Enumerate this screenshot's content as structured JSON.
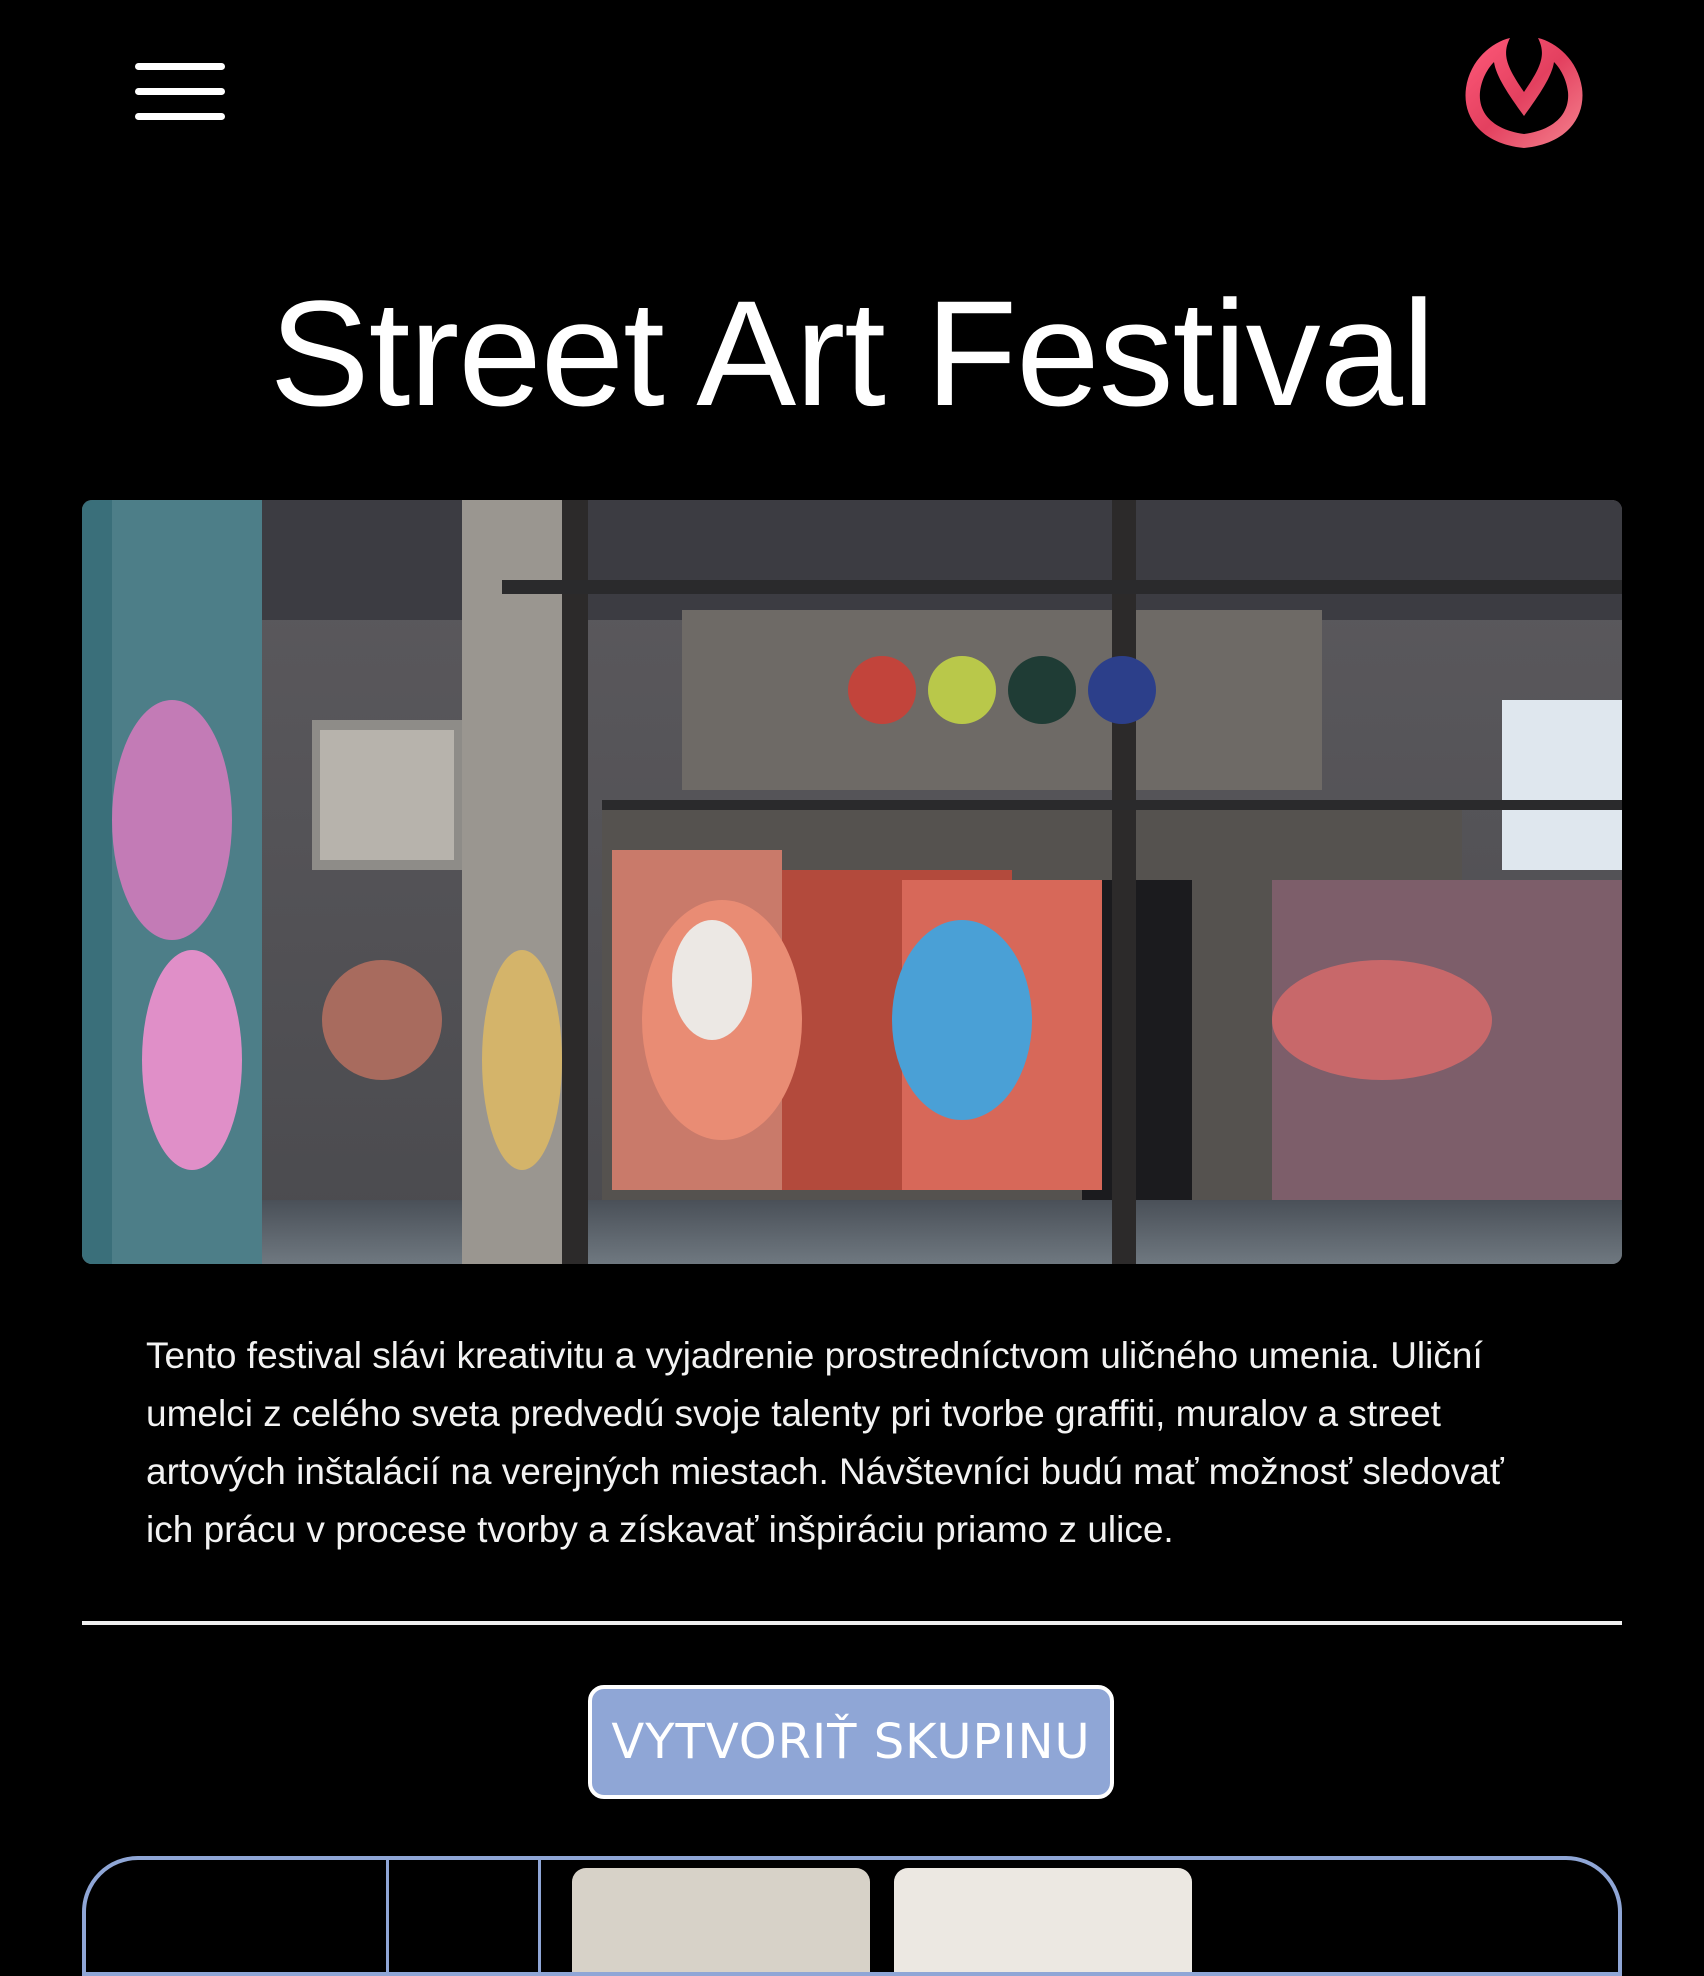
{
  "header": {
    "menu_icon": "hamburger-menu-icon",
    "logo_icon": "m-logo-icon",
    "logo_gradient": [
      "#ff4f6d",
      "#e8486b",
      "#f07a86"
    ]
  },
  "event": {
    "title": "Street Art Festival",
    "hero_image": "graffiti-warehouse-photo",
    "description": "Tento festival slávi kreativitu a vyjadrenie prostredníctvom uličného umenia. Uliční umelci z celého sveta predvedú svoje talenty pri tvorbe graffiti, muralov a street artových inštalácií na verejných miestach. Návštevníci budú mať možnosť sledovať ich prácu v procese tvorby a získavať inšpiráciu priamo z ulice."
  },
  "actions": {
    "create_group_label": "VYTVORIŤ SKUPINU"
  },
  "colors": {
    "background": "#000000",
    "text": "#ffffff",
    "accent": "#8fa6d6"
  }
}
